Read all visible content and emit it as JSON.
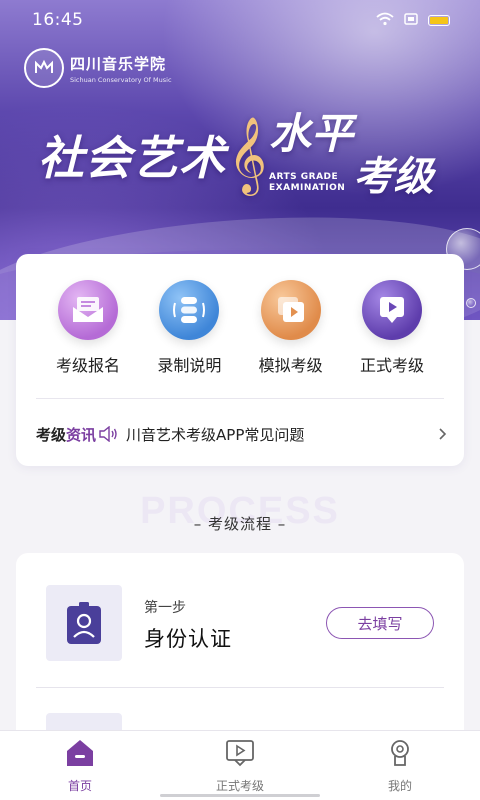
{
  "status_bar": {
    "time": "16:45",
    "icons": [
      "wifi-icon",
      "sim-icon",
      "battery-icon"
    ],
    "battery_color": "#f5c518"
  },
  "banner": {
    "logo_cn": "四川音乐学院",
    "logo_en": "Sichuan Conservatory Of Music",
    "title_left": "社会艺术",
    "title_right_top": "水平",
    "title_right_bottom": "考级",
    "title_en_line1": "ARTS GRADE",
    "title_en_line2": "EXAMINATION"
  },
  "menu": {
    "items": [
      {
        "label": "考级报名",
        "icon": "envelope-icon",
        "color": "#b56bd6"
      },
      {
        "label": "录制说明",
        "icon": "document-stack-icon",
        "color": "#3f86d8"
      },
      {
        "label": "模拟考级",
        "icon": "video-stack-icon",
        "color": "#e08b4a"
      },
      {
        "label": "正式考级",
        "icon": "play-screen-icon",
        "color": "#5e3dac"
      }
    ]
  },
  "news": {
    "tag_part1": "考级",
    "tag_part2": "资讯",
    "text": "川音艺术考级APP常见问题",
    "accent_color": "#7b3fa1"
  },
  "process": {
    "watermark": "PROCESS",
    "title": "– 考级流程 –"
  },
  "steps": [
    {
      "number": "第一步",
      "name": "身份认证",
      "button": "去填写",
      "icon": "id-badge-icon"
    }
  ],
  "bottom_nav": {
    "items": [
      {
        "label": "首页",
        "icon": "home-icon",
        "active": true
      },
      {
        "label": "正式考级",
        "icon": "exam-screen-icon",
        "active": false
      },
      {
        "label": "我的",
        "icon": "profile-icon",
        "active": false
      }
    ],
    "active_color": "#7b3fa1"
  }
}
